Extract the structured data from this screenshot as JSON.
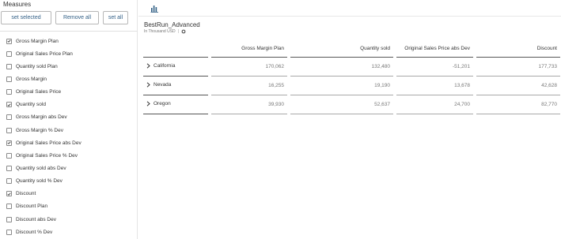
{
  "left_panel": {
    "title": "Measures",
    "buttons": {
      "set_selected": "set selected",
      "remove_all": "Remove all",
      "set_all": "set all"
    },
    "measures": [
      {
        "label": "Gross Margin Plan",
        "checked": true
      },
      {
        "label": "Original Sales Price Plan",
        "checked": false
      },
      {
        "label": "Quantity sold Plan",
        "checked": false
      },
      {
        "label": "Gross Margin",
        "checked": false
      },
      {
        "label": "Original Sales Price",
        "checked": false
      },
      {
        "label": "Quantity sold",
        "checked": true
      },
      {
        "label": "Gross Margin abs Dev",
        "checked": false
      },
      {
        "label": "Gross Margin % Dev",
        "checked": false
      },
      {
        "label": "Original Sales Price abs Dev",
        "checked": true
      },
      {
        "label": "Original Sales Price % Dev",
        "checked": false
      },
      {
        "label": "Quantity sold abs Dev",
        "checked": false
      },
      {
        "label": "Quantity sold % Dev",
        "checked": false
      },
      {
        "label": "Discount",
        "checked": true
      },
      {
        "label": "Discount Plan",
        "checked": false
      },
      {
        "label": "Discount abs Dev",
        "checked": false
      },
      {
        "label": "Discount % Dev",
        "checked": false
      }
    ]
  },
  "toolbar": {
    "chart_icon": "bar-chart-icon"
  },
  "table": {
    "title": "BestRun_Advanced",
    "subtitle": "In Thousand USD",
    "columns": [
      "Gross Margin Plan",
      "Quantity sold",
      "Original Sales Price abs Dev",
      "Discount"
    ],
    "rows": [
      {
        "label": "California",
        "values": [
          "170,062",
          "132,480",
          "-51,201",
          "177,733"
        ]
      },
      {
        "label": "Nevada",
        "values": [
          "16,255",
          "19,190",
          "13,678",
          "42,628"
        ]
      },
      {
        "label": "Oregon",
        "values": [
          "39,930",
          "52,637",
          "24,700",
          "82,770"
        ]
      }
    ]
  },
  "colors": {
    "accent": "#346187",
    "border": "#b7b7b7"
  }
}
